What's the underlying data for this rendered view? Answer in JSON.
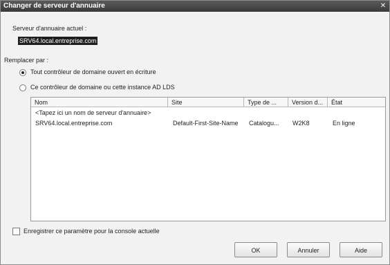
{
  "window": {
    "title": "Changer de serveur d'annuaire",
    "close_symbol": "✕"
  },
  "current_server": {
    "label": "Serveur d'annuaire actuel :",
    "value": "SRV64.local.entreprise.com"
  },
  "replace": {
    "label": "Remplacer par :",
    "options": [
      {
        "label": "Tout contrôleur de domaine ouvert en écriture",
        "selected": true
      },
      {
        "label": "Ce contrôleur de domaine ou cette instance AD LDS",
        "selected": false
      }
    ]
  },
  "table": {
    "columns": [
      "Nom",
      "Site",
      "Type de ...",
      "Version d...",
      "État"
    ],
    "placeholder_row": "<Tapez ici un nom de serveur d'annuaire>",
    "rows": [
      [
        "SRV64.local.entreprise.com",
        "Default-First-Site-Name",
        "Catalogu...",
        "W2K8",
        "En ligne"
      ]
    ]
  },
  "save_setting": {
    "label": "Enregistrer ce paramètre pour la console actuelle",
    "checked": false
  },
  "buttons": {
    "ok": "OK",
    "cancel": "Annuler",
    "help": "Aide"
  }
}
